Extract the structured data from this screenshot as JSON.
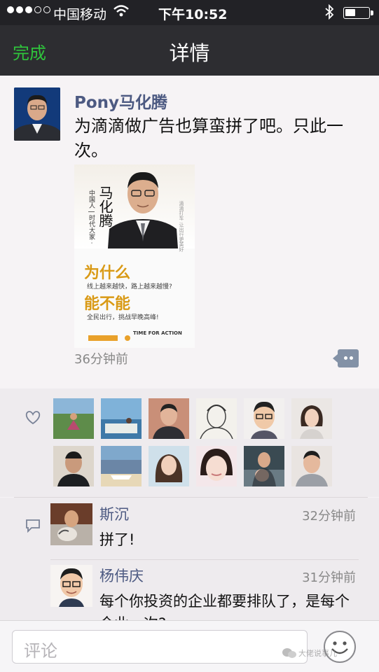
{
  "status_bar": {
    "carrier": "中国移动",
    "time": "下午10:52"
  },
  "nav": {
    "done_label": "完成",
    "title": "详情"
  },
  "post": {
    "author": "Pony马化腾",
    "content": "为滴滴做广告也算蛮拼了吧。只此一次。",
    "time": "36分钟前",
    "poster": {
      "small_label": "中国人 | 时代大家 ·",
      "name": "马化腾",
      "side_text": "滴滴打车 让出行更美好",
      "headline1": "为什么",
      "sub1": "线上越来越快，路上越来越慢?",
      "headline2": "能不能",
      "sub2": "全民出行，挑战早晚高峰!",
      "logo_text": "TIME FOR ACTION"
    }
  },
  "likes": {
    "avatar_count": 12
  },
  "comments": [
    {
      "name": "斯沉",
      "time": "32分钟前",
      "text": "拼了!"
    },
    {
      "name": "杨伟庆",
      "time": "31分钟前",
      "text": "每个你投资的企业都要排队了，是每个企业一次?"
    }
  ],
  "input": {
    "placeholder": "评论"
  },
  "watermark": "大佬说事儿"
}
